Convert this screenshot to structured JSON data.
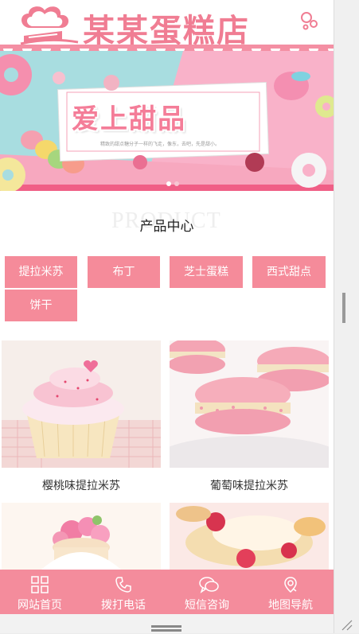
{
  "header": {
    "shop_name": "某某蛋糕店",
    "menu_icon": "settings-bubbles-icon",
    "logo_icon": "chef-hat-cake-icon"
  },
  "banner": {
    "title": "爱上甜品",
    "subtitle": "精致的甜点糖分子一样的飞走，像东，去吧，先是甜小。",
    "slides_count": 2
  },
  "section": {
    "title": "产品中心",
    "title_bg": "PRODUCT"
  },
  "categories": [
    "提拉米苏",
    "布丁",
    "芝士蛋糕",
    "西式甜点",
    "饼干"
  ],
  "products": [
    {
      "name": "樱桃味提拉米苏"
    },
    {
      "name": "葡萄味提拉米苏"
    },
    {
      "name": ""
    },
    {
      "name": ""
    }
  ],
  "bottom_nav": [
    {
      "label": "网站首页",
      "icon": "grid-icon"
    },
    {
      "label": "拨打电话",
      "icon": "phone-icon"
    },
    {
      "label": "短信咨询",
      "icon": "message-icon"
    },
    {
      "label": "地图导航",
      "icon": "map-pin-icon"
    }
  ],
  "colors": {
    "accent": "#f58b9a",
    "brand_text": "#f07d93",
    "nav_bg": "#f48c9c"
  }
}
